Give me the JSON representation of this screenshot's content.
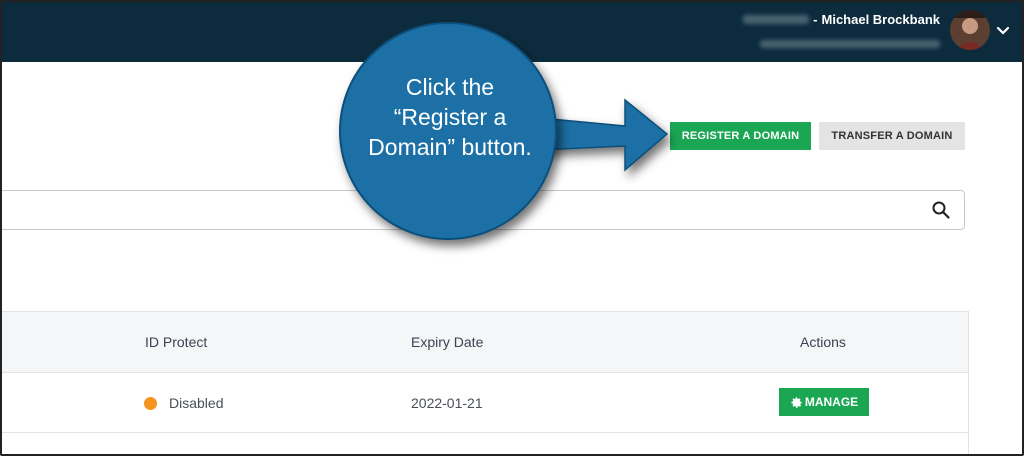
{
  "header": {
    "user_name": "Michael Brockbank",
    "name_prefix": "-"
  },
  "actions": {
    "register_label": "REGISTER A DOMAIN",
    "transfer_label": "TRANSFER A DOMAIN"
  },
  "search": {
    "placeholder": ""
  },
  "table": {
    "columns": [
      "ID Protect",
      "Expiry Date",
      "Actions"
    ],
    "rows": [
      {
        "id_protect": "Disabled",
        "expiry_date": "2022-01-21",
        "action_label": "MANAGE"
      }
    ]
  },
  "callout": {
    "line1": "Click the",
    "line2": "“Register a",
    "line3": "Domain” button."
  },
  "colors": {
    "topbar": "#0c2c3e",
    "primary_green": "#1aa653",
    "callout_blue": "#1a6fa5",
    "status_disabled": "#f7941d"
  },
  "icons": {
    "search": "search-icon",
    "chevron": "chevron-down-icon",
    "gear": "gear-icon"
  }
}
